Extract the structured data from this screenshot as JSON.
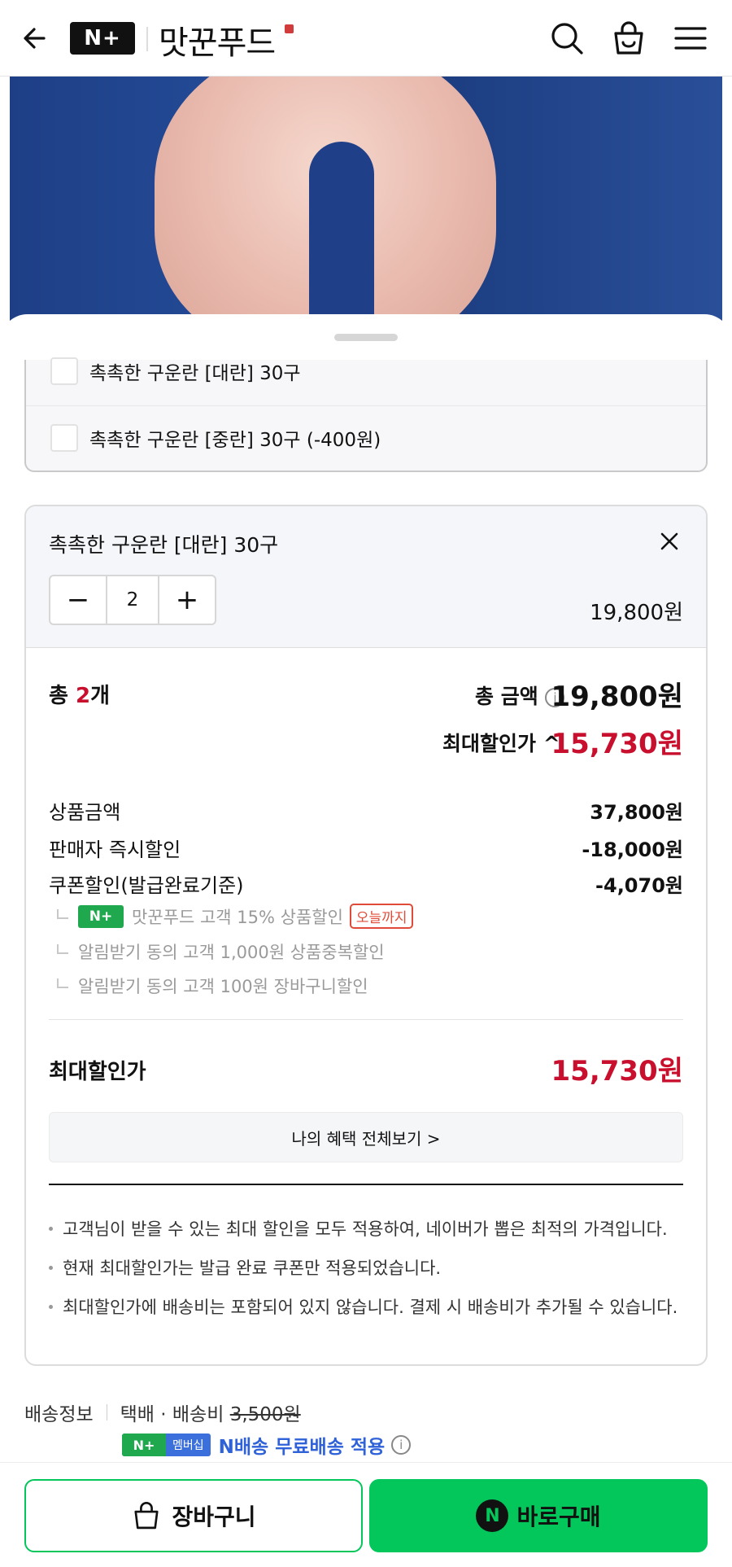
{
  "header": {
    "logo": "N+",
    "store_name": "맛꾼푸드"
  },
  "options": [
    {
      "label": "촉촉한 구운란 [대란] 30구"
    },
    {
      "label": "촉촉한 구운란 [중란] 30구 (-400원)"
    }
  ],
  "selected": {
    "title": "촉촉한 구운란 [대란] 30구",
    "quantity": "2",
    "minus": "−",
    "plus": "+",
    "price": "19,800원"
  },
  "totals": {
    "count_prefix": "총 ",
    "count_value": "2",
    "count_suffix": "개",
    "amount_label": "총 금액",
    "amount_value": "19,800원",
    "max_label": "최대할인가",
    "max_value": "15,730원"
  },
  "breakdown": [
    {
      "label": "상품금액",
      "value": "37,800원"
    },
    {
      "label": "판매자 즉시할인",
      "value": "-18,000원"
    },
    {
      "label": "쿠폰할인(발급완료기준)",
      "value": "-4,070원"
    }
  ],
  "coupon_items": {
    "item1": "맛꾼푸드 고객 15% 상품할인",
    "item1_badge": "오늘까지",
    "item2": "알림받기 동의 고객 1,000원 상품중복할인",
    "item3": "알림받기 동의 고객 100원 장바구니할인"
  },
  "final": {
    "label": "최대할인가",
    "value": "15,730원"
  },
  "benefit_button": "나의 혜택 전체보기 >",
  "notes": [
    "고객님이 받을 수 있는 최대 할인을 모두 적용하여, 네이버가 뽑은 최적의 가격입니다.",
    "현재 최대할인가는 발급 완료 쿠폰만 적용되었습니다.",
    "최대할인가에 배송비는 포함되어 있지 않습니다. 결제 시 배송비가 추가될 수 있습니다."
  ],
  "delivery": {
    "label": "배송정보",
    "method": "택배 · 배송비",
    "fee": "3,500원",
    "badge_n": "N+",
    "badge_member": "멤버십",
    "free_text": "N배송 무료배송 적용"
  },
  "buttons": {
    "cart": "장바구니",
    "buy": "바로구매",
    "npay": "N"
  },
  "colors": {
    "accent_red": "#c8102e",
    "naver_green": "#03c75a",
    "link_blue": "#2f62d8"
  }
}
